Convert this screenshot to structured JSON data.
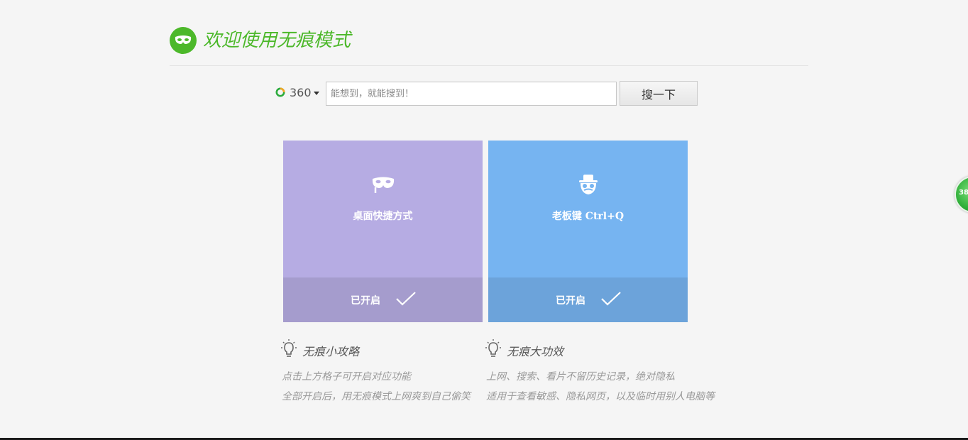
{
  "header": {
    "title": "欢迎使用无痕模式"
  },
  "search": {
    "engine_label": "360",
    "placeholder": "能想到，就能搜到！",
    "value": "",
    "button_label": "搜一下"
  },
  "tiles": [
    {
      "label": "桌面快捷方式",
      "status": "已开启",
      "icon": "mask-icon",
      "color": "#b6ace3"
    },
    {
      "label": "老板键 Ctrl+Q",
      "status": "已开启",
      "icon": "spy-icon",
      "color": "#76b4f1"
    }
  ],
  "tips": [
    {
      "title": "无痕小攻略",
      "lines": [
        "点击上方格子可开启对应功能",
        "全部开启后，用无痕模式上网爽到自己偷笑"
      ]
    },
    {
      "title": "无痕大功效",
      "lines": [
        "上网、搜索、看片不留历史记录，绝对隐私",
        "适用于查看敏感、隐私网页，以及临时用别人电脑等"
      ]
    }
  ],
  "float_ball": {
    "text": "38"
  },
  "colors": {
    "brand_green": "#4cb82a",
    "tile_purple": "#b6ace3",
    "tile_blue": "#76b4f1"
  }
}
